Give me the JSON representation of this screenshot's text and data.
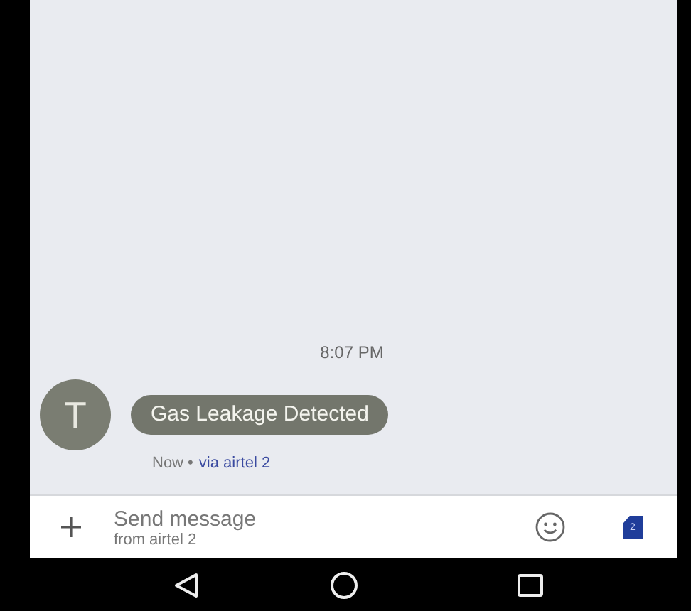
{
  "conversation": {
    "timestamp": "8:07 PM",
    "message": {
      "avatar_letter": "T",
      "text": "Gas Leakage Detected",
      "status": "Now •",
      "via": "via airtel 2"
    }
  },
  "composer": {
    "placeholder": "Send message",
    "subtitle": "from airtel 2",
    "sim_label": "2"
  }
}
